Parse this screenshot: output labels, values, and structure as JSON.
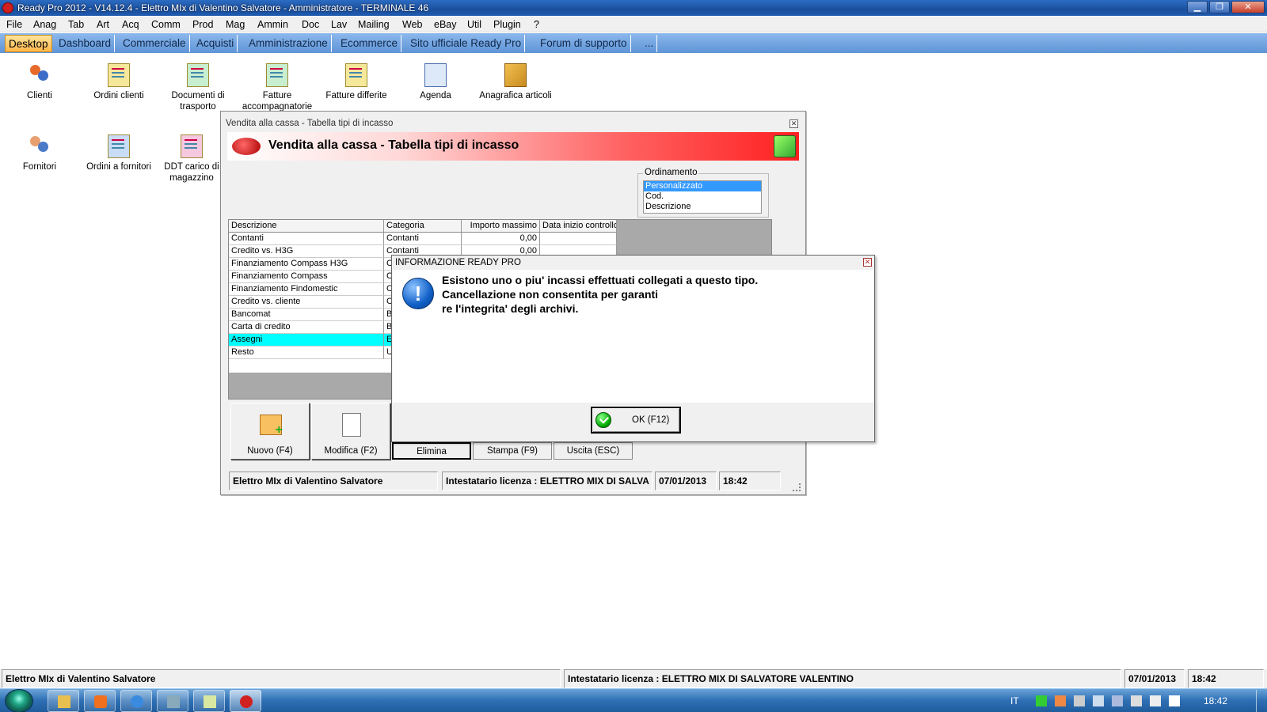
{
  "window": {
    "title": "Ready Pro 2012 - V14.12.4 - Elettro MIx di Valentino Salvatore - Amministratore - TERMINALE 46",
    "minimize": "▁",
    "maximize": "❐",
    "close": "✕"
  },
  "menu": [
    "File",
    "Anag",
    "Tab",
    "Art",
    "Acq",
    "Comm",
    "Prod",
    "Mag",
    "Ammin",
    "Doc",
    "Lav",
    "Mailing",
    "Web",
    "eBay",
    "Util",
    "Plugin",
    "?"
  ],
  "tabs": [
    {
      "label": "Desktop",
      "active": true
    },
    {
      "label": "Dashboard"
    },
    {
      "label": "Commerciale"
    },
    {
      "label": "Acquisti"
    },
    {
      "label": "Amministrazione"
    },
    {
      "label": "Ecommerce"
    },
    {
      "label": "Sito ufficiale Ready Pro"
    },
    {
      "label": "Forum di supporto"
    },
    {
      "label": "..."
    }
  ],
  "desktop_icons": [
    {
      "label": "Clienti",
      "icon": "people-icon"
    },
    {
      "label": "Ordini clienti",
      "icon": "order-document-icon"
    },
    {
      "label": "Documenti di trasporto",
      "icon": "document-icon"
    },
    {
      "label": "Fatture accompagnatorie",
      "icon": "invoice-icon"
    },
    {
      "label": "Fatture differite",
      "icon": "invoice-icon"
    },
    {
      "label": "Agenda",
      "icon": "calendar-icon"
    },
    {
      "label": "Anagrafica articoli",
      "icon": "box-icon"
    },
    {
      "label": "Fornitori",
      "icon": "suppliers-icon"
    },
    {
      "label": "Ordini a fornitori",
      "icon": "order-document-icon"
    },
    {
      "label": "DDT carico di magazzino",
      "icon": "document-icon"
    }
  ],
  "main_window": {
    "title": "Vendita alla cassa - Tabella tipi di incasso",
    "banner_title": "Vendita alla cassa - Tabella tipi di incasso",
    "ordinamento": {
      "legend": "Ordinamento",
      "options": [
        "Personalizzato",
        "Cod.",
        "Descrizione"
      ],
      "selected": "Personalizzato"
    },
    "table": {
      "columns": [
        "Descrizione",
        "Categoria",
        "Importo massimo",
        "Data inizio controllo"
      ],
      "rows": [
        [
          "Contanti",
          "Contanti",
          "0,00",
          ""
        ],
        [
          "Credito vs. H3G",
          "Contanti",
          "0,00",
          ""
        ],
        [
          "Finanziamento Compass H3G",
          "C",
          "",
          ""
        ],
        [
          "Finanziamento Compass",
          "C",
          "",
          ""
        ],
        [
          "Finanziamento Findomestic",
          "C",
          "",
          ""
        ],
        [
          "Credito vs. cliente",
          "C",
          "",
          ""
        ],
        [
          "Bancomat",
          "B",
          "",
          ""
        ],
        [
          "Carta di credito",
          "B",
          "",
          ""
        ],
        [
          "Assegni",
          "E",
          "",
          ""
        ],
        [
          "Resto",
          "U",
          "",
          ""
        ]
      ],
      "selected_row": 8
    },
    "buttons": {
      "nuovo": "Nuovo (F4)",
      "modifica": "Modifica (F2)",
      "elimina": "Elimina",
      "stampa": "Stampa (F9)",
      "uscita": "Uscita (ESC)"
    },
    "status": {
      "company": "Elettro MIx di Valentino Salvatore",
      "license": "Intestatario licenza : ELETTRO MIX DI SALVA",
      "date": "07/01/2013",
      "time": "18:42"
    }
  },
  "dialog": {
    "title": "INFORMAZIONE READY PRO",
    "message": "Esistono uno o piu' incassi effettuati collegati a questo tipo.\nCancellazione non consentita per garanti\nre l'integrita' degli archivi.",
    "ok_label": "OK (F12)"
  },
  "statusbar": {
    "company": "Elettro MIx di Valentino Salvatore",
    "license": "Intestatario licenza : ELETTRO MIX DI SALVATORE VALENTINO",
    "date": "07/01/2013",
    "time": "18:42"
  },
  "taskbar": {
    "language": "IT",
    "clock": "18:42"
  },
  "colors": {
    "tab_active": "#ffb64a",
    "selected_row": "#00ffff",
    "list_selection": "#3399ff",
    "banner_red": "#ff2020"
  }
}
